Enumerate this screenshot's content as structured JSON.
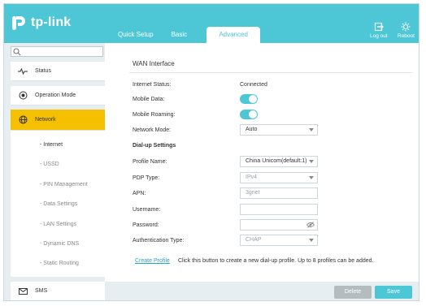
{
  "brand": {
    "name": "tp-link"
  },
  "tabs": [
    {
      "label": "Quick Setup"
    },
    {
      "label": "Basic"
    },
    {
      "label": "Advanced"
    }
  ],
  "header_buttons": {
    "logout": "Log out",
    "reboot": "Reboot"
  },
  "sidebar": {
    "search_placeholder": "",
    "items": [
      {
        "label": "Status",
        "icon": "pulse-icon"
      },
      {
        "label": "Operation Mode",
        "icon": "toggle-icon"
      },
      {
        "label": "Network",
        "icon": "globe-icon"
      },
      {
        "label": "SMS",
        "icon": "envelope-icon"
      }
    ],
    "subitems": [
      {
        "label": "- Internet"
      },
      {
        "label": "- USSD"
      },
      {
        "label": "- PIN Management"
      },
      {
        "label": "- Data Settings"
      },
      {
        "label": "- LAN Settings"
      },
      {
        "label": "- Dynamic DNS"
      },
      {
        "label": "- Static Routing"
      }
    ]
  },
  "wan": {
    "title": "WAN Interface",
    "internet_status_label": "Internet Status:",
    "internet_status_value": "Connected",
    "mobile_data_label": "Mobile Data:",
    "mobile_data_on": true,
    "mobile_roaming_label": "Mobile Roaming:",
    "mobile_roaming_on": true,
    "network_mode_label": "Network Mode:",
    "network_mode_value": "Auto"
  },
  "dialup": {
    "title": "Dial-up Settings",
    "profile_name_label": "Profile Name:",
    "profile_name_value": "China Unicom(default:1)",
    "pdp_type_label": "PDP Type:",
    "pdp_type_value": "IPv4",
    "apn_label": "APN:",
    "apn_value": "3gnet",
    "username_label": "Username:",
    "username_value": "",
    "password_label": "Password:",
    "password_value": "",
    "auth_type_label": "Authentication Type:",
    "auth_type_value": "CHAP"
  },
  "create_profile": {
    "link": "Create Profile",
    "hint": "Click this button to create a new dial-up profile. Up to 8 profiles can be added."
  },
  "footer": {
    "delete": "Delete",
    "save": "Save"
  },
  "colors": {
    "accent": "#4dc6d5",
    "active_menu": "#f5c000",
    "link": "#2aa3c4"
  }
}
